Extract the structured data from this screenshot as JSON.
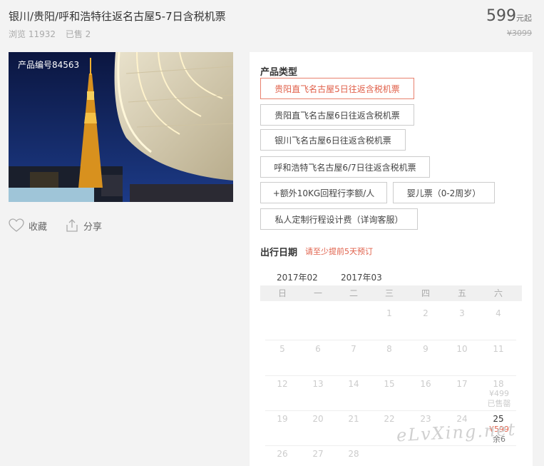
{
  "product": {
    "title": "银川/贵阳/呼和浩特往返名古屋5-7日含税机票",
    "views": "浏览 11932",
    "sold": "已售 2",
    "price": "599",
    "price_suffix": "元起",
    "original_price": "¥3099",
    "product_id": "产品编号84563"
  },
  "actions": {
    "favorite": "收藏",
    "share": "分享"
  },
  "product_types": {
    "label": "产品类型",
    "options": [
      "贵阳直飞名古屋5日往返含税机票",
      "贵阳直飞名古屋6日往返含税机票",
      "银川飞名古屋6日往返含税机票",
      "呼和浩特飞名古屋6/7日往返含税机票",
      "+额外10KG回程行李额/人",
      "婴儿票（0-2周岁）",
      "私人定制行程设计费（详询客服）"
    ],
    "selected_index": 0
  },
  "travel_date": {
    "label": "出行日期",
    "tip": "请至少提前5天预订",
    "months": [
      "2017年02",
      "2017年03"
    ],
    "weekdays": [
      "日",
      "一",
      "二",
      "三",
      "四",
      "五",
      "六"
    ],
    "rows": [
      [
        "",
        "",
        "",
        "1",
        "2",
        "3",
        "4"
      ],
      [
        "5",
        "6",
        "7",
        "8",
        "9",
        "10",
        "11"
      ],
      [
        "12",
        "13",
        "14",
        "15",
        "16",
        "17",
        "18"
      ],
      [
        "19",
        "20",
        "21",
        "22",
        "23",
        "24",
        "25"
      ],
      [
        "26",
        "27",
        "28",
        "",
        "",
        "",
        ""
      ]
    ],
    "day18_price": "¥499",
    "day18_status": "已售罄",
    "day25_price": "¥599",
    "day25_stock": "余6"
  },
  "watermark": "eLvXing.net",
  "colors": {
    "accent": "#e0604a",
    "selected_border": "#e8816e"
  }
}
